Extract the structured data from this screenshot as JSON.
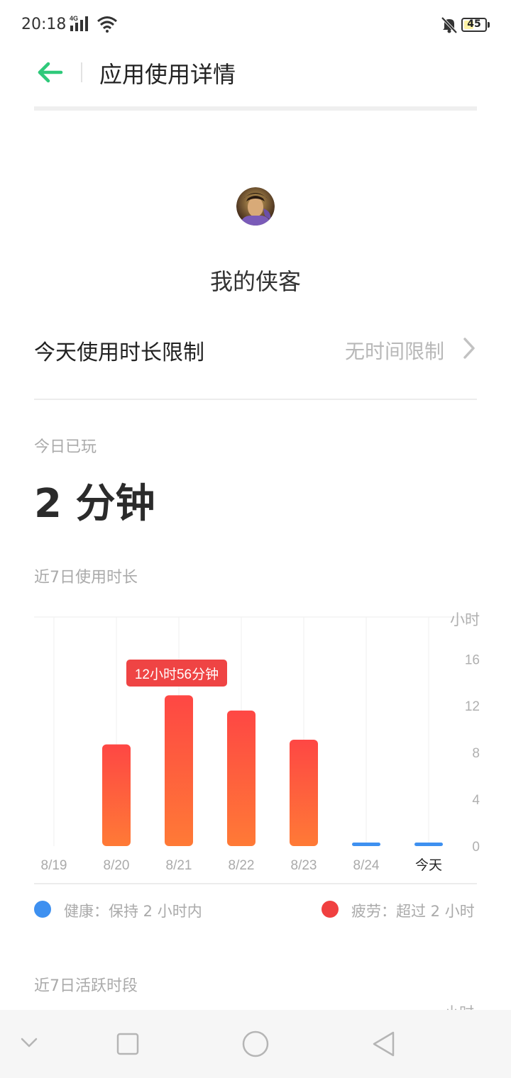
{
  "status_bar": {
    "time": "20:18",
    "network": "4G",
    "battery": "45",
    "battery_level": 0.45
  },
  "header": {
    "title": "应用使用详情",
    "back_icon": "arrow-left-icon",
    "accent_color": "#2ec97a"
  },
  "app": {
    "name": "我的侠客",
    "icon": "app-avatar-icon"
  },
  "limit": {
    "label": "今天使用时长限制",
    "value": "无时间限制"
  },
  "today": {
    "label": "今日已玩",
    "value": "2 分钟"
  },
  "weekly_usage": {
    "title": "近7日使用时长",
    "tooltip": "12小时56分钟"
  },
  "legend": {
    "healthy": "健康：保持 2 小时内",
    "fatigue": "疲劳：超过 2 小时",
    "healthy_color": "#3e90f0",
    "fatigue_color": "#f04040"
  },
  "active_periods": {
    "title": "近7日活跃时段",
    "unit_partial": "小时"
  },
  "chart_data": {
    "type": "bar",
    "categories": [
      "8/19",
      "8/20",
      "8/21",
      "8/22",
      "8/23",
      "8/24",
      "今天"
    ],
    "values": [
      0,
      8.7,
      12.9,
      11.6,
      9.1,
      0.05,
      0.03
    ],
    "status": [
      "none",
      "fatigue",
      "fatigue",
      "fatigue",
      "fatigue",
      "healthy",
      "healthy"
    ],
    "ylabel": "小时",
    "yticks": [
      0,
      4,
      8,
      12,
      16
    ],
    "ylim": [
      0,
      19.6
    ],
    "highlight_index": 2,
    "grid": true
  }
}
